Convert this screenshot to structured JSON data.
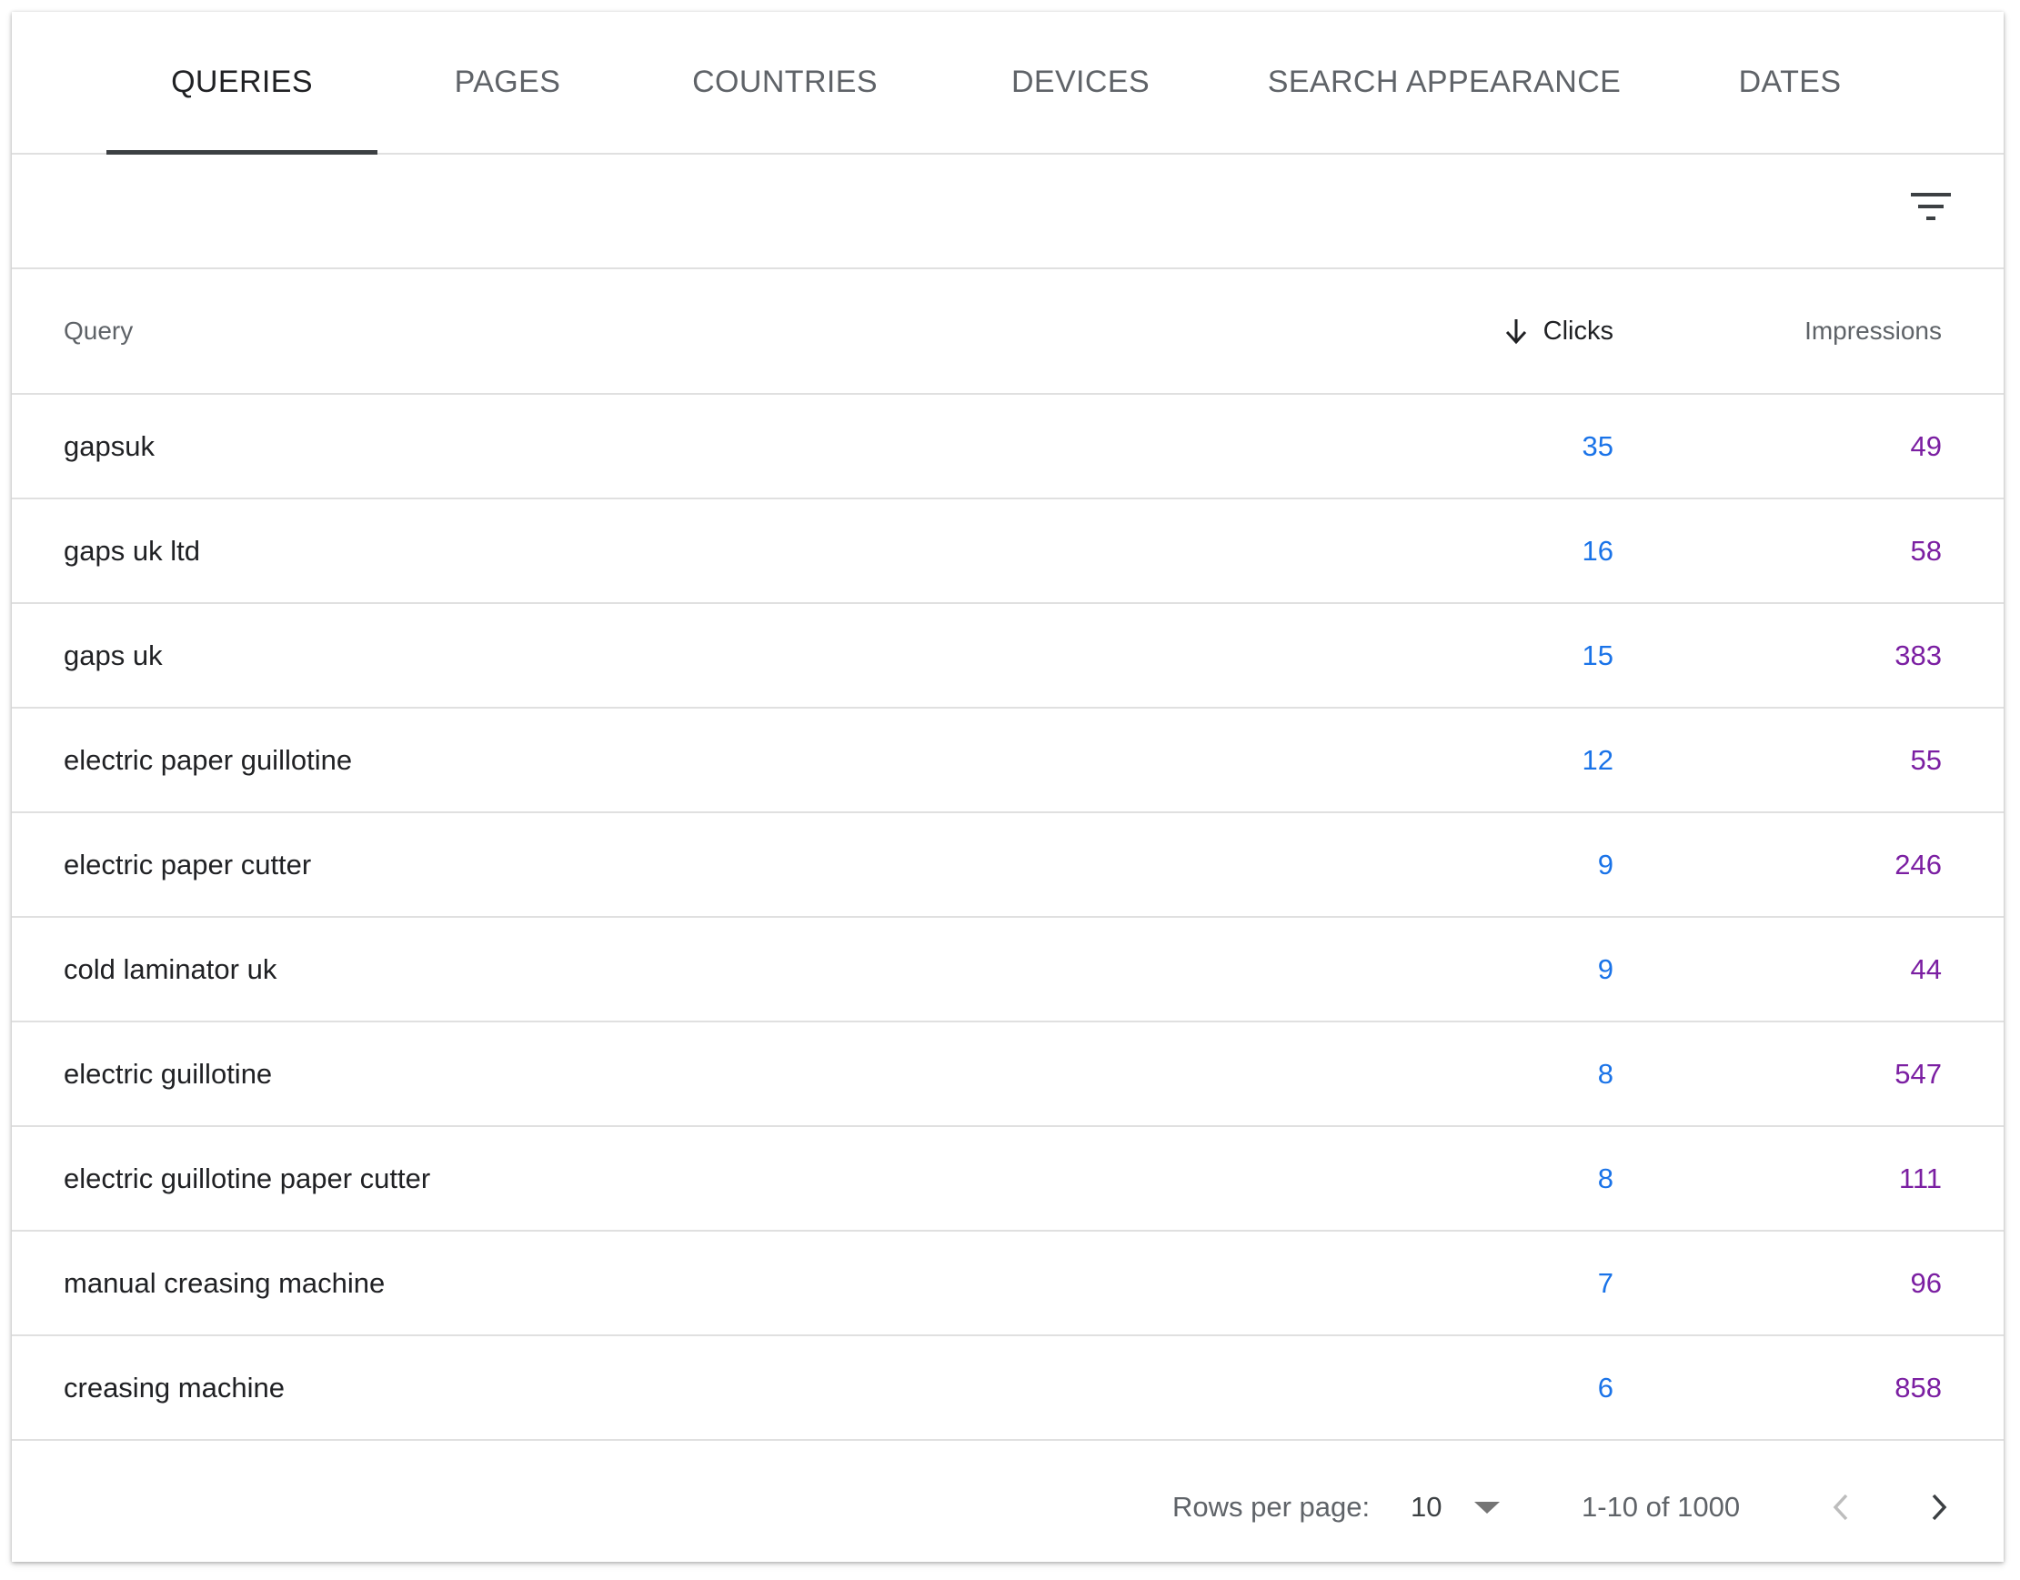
{
  "tabs": [
    {
      "label": "QUERIES",
      "active": true
    },
    {
      "label": "PAGES",
      "active": false
    },
    {
      "label": "COUNTRIES",
      "active": false
    },
    {
      "label": "DEVICES",
      "active": false
    },
    {
      "label": "SEARCH APPEARANCE",
      "active": false
    },
    {
      "label": "DATES",
      "active": false
    }
  ],
  "filter": {
    "icon": "filter-list-icon"
  },
  "table": {
    "columns": {
      "query": "Query",
      "clicks": "Clicks",
      "impressions": "Impressions"
    },
    "sort": {
      "column": "clicks",
      "direction": "descending",
      "icon": "arrow-down-icon"
    },
    "rows": [
      {
        "query": "gapsuk",
        "clicks": "35",
        "impressions": "49"
      },
      {
        "query": "gaps uk ltd",
        "clicks": "16",
        "impressions": "58"
      },
      {
        "query": "gaps uk",
        "clicks": "15",
        "impressions": "383"
      },
      {
        "query": "electric paper guillotine",
        "clicks": "12",
        "impressions": "55"
      },
      {
        "query": "electric paper cutter",
        "clicks": "9",
        "impressions": "246"
      },
      {
        "query": "cold laminator uk",
        "clicks": "9",
        "impressions": "44"
      },
      {
        "query": "electric guillotine",
        "clicks": "8",
        "impressions": "547"
      },
      {
        "query": "electric guillotine paper cutter",
        "clicks": "8",
        "impressions": "111"
      },
      {
        "query": "manual creasing machine",
        "clicks": "7",
        "impressions": "96"
      },
      {
        "query": "creasing machine",
        "clicks": "6",
        "impressions": "858"
      }
    ]
  },
  "pagination": {
    "rows_per_page_label": "Rows per page:",
    "rows_per_page_value": "10",
    "range": "1-10 of 1000"
  },
  "colors": {
    "clicks": "#1a73e8",
    "impressions": "#7b1fa2",
    "active_tab_indicator": "#3c4043"
  }
}
